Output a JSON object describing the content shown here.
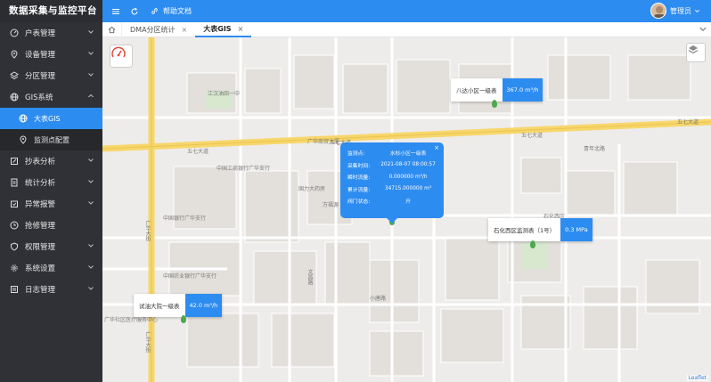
{
  "app": {
    "title": "数据采集与监控平台"
  },
  "sidebar": {
    "items": [
      {
        "label": "户表管理",
        "icon": "gauge-icon"
      },
      {
        "label": "设备管理",
        "icon": "location-icon"
      },
      {
        "label": "分区管理",
        "icon": "layers-icon"
      },
      {
        "label": "GIS系统",
        "icon": "globe-icon"
      },
      {
        "label": "大表GIS",
        "icon": "globe-icon"
      },
      {
        "label": "监测点配置",
        "icon": "location-icon"
      },
      {
        "label": "抄表分析",
        "icon": "edit-icon"
      },
      {
        "label": "统计分析",
        "icon": "document-icon"
      },
      {
        "label": "异常报警",
        "icon": "calendar-icon"
      },
      {
        "label": "抢修管理",
        "icon": "clock-icon"
      },
      {
        "label": "权限管理",
        "icon": "shield-icon"
      },
      {
        "label": "系统设置",
        "icon": "gear-icon"
      },
      {
        "label": "日志管理",
        "icon": "log-icon"
      }
    ]
  },
  "topbar": {
    "help": "帮助文档",
    "user": "管理员"
  },
  "tabs": [
    {
      "label": "DMA分区统计"
    },
    {
      "label": "大表GIS"
    }
  ],
  "map": {
    "streets": [
      "五七大道",
      "五七大道",
      "五七大道",
      "五七大道",
      "广华大街",
      "广华大街",
      "江汉油田一中",
      "中国工商银行广华支行",
      "中国银行广华支行",
      "中国农业银行广华支行",
      "广华社区医疗服务中心",
      "广华商贸大厦",
      "万福源",
      "国力大药房",
      "文昌路",
      "石化西区",
      "小唐路",
      "青年北路"
    ],
    "markers": [
      {
        "name": "八达小区一级表",
        "value": "367.0 m³/h"
      },
      {
        "name": "石化西区监测表（1号）",
        "value": "0.3 MPa"
      },
      {
        "name": "试油大院一级表",
        "value": "42.0 m³/h"
      }
    ],
    "popup": {
      "rows": [
        {
          "k": "监测点:",
          "v": "水杉小区一级表"
        },
        {
          "k": "采集时间:",
          "v": "2021-08-07 08:00:57"
        },
        {
          "k": "瞬时流量:",
          "v": "0.000000 m³/h"
        },
        {
          "k": "累计流量:",
          "v": "34715.000000 m³"
        },
        {
          "k": "阀门状态:",
          "v": "开"
        }
      ]
    },
    "attribution": "Leaflet"
  },
  "colors": {
    "accent": "#2d8cf0",
    "sidebar": "#2f3136",
    "road_major": "#f7d66b",
    "marker": "#4fa84a"
  }
}
